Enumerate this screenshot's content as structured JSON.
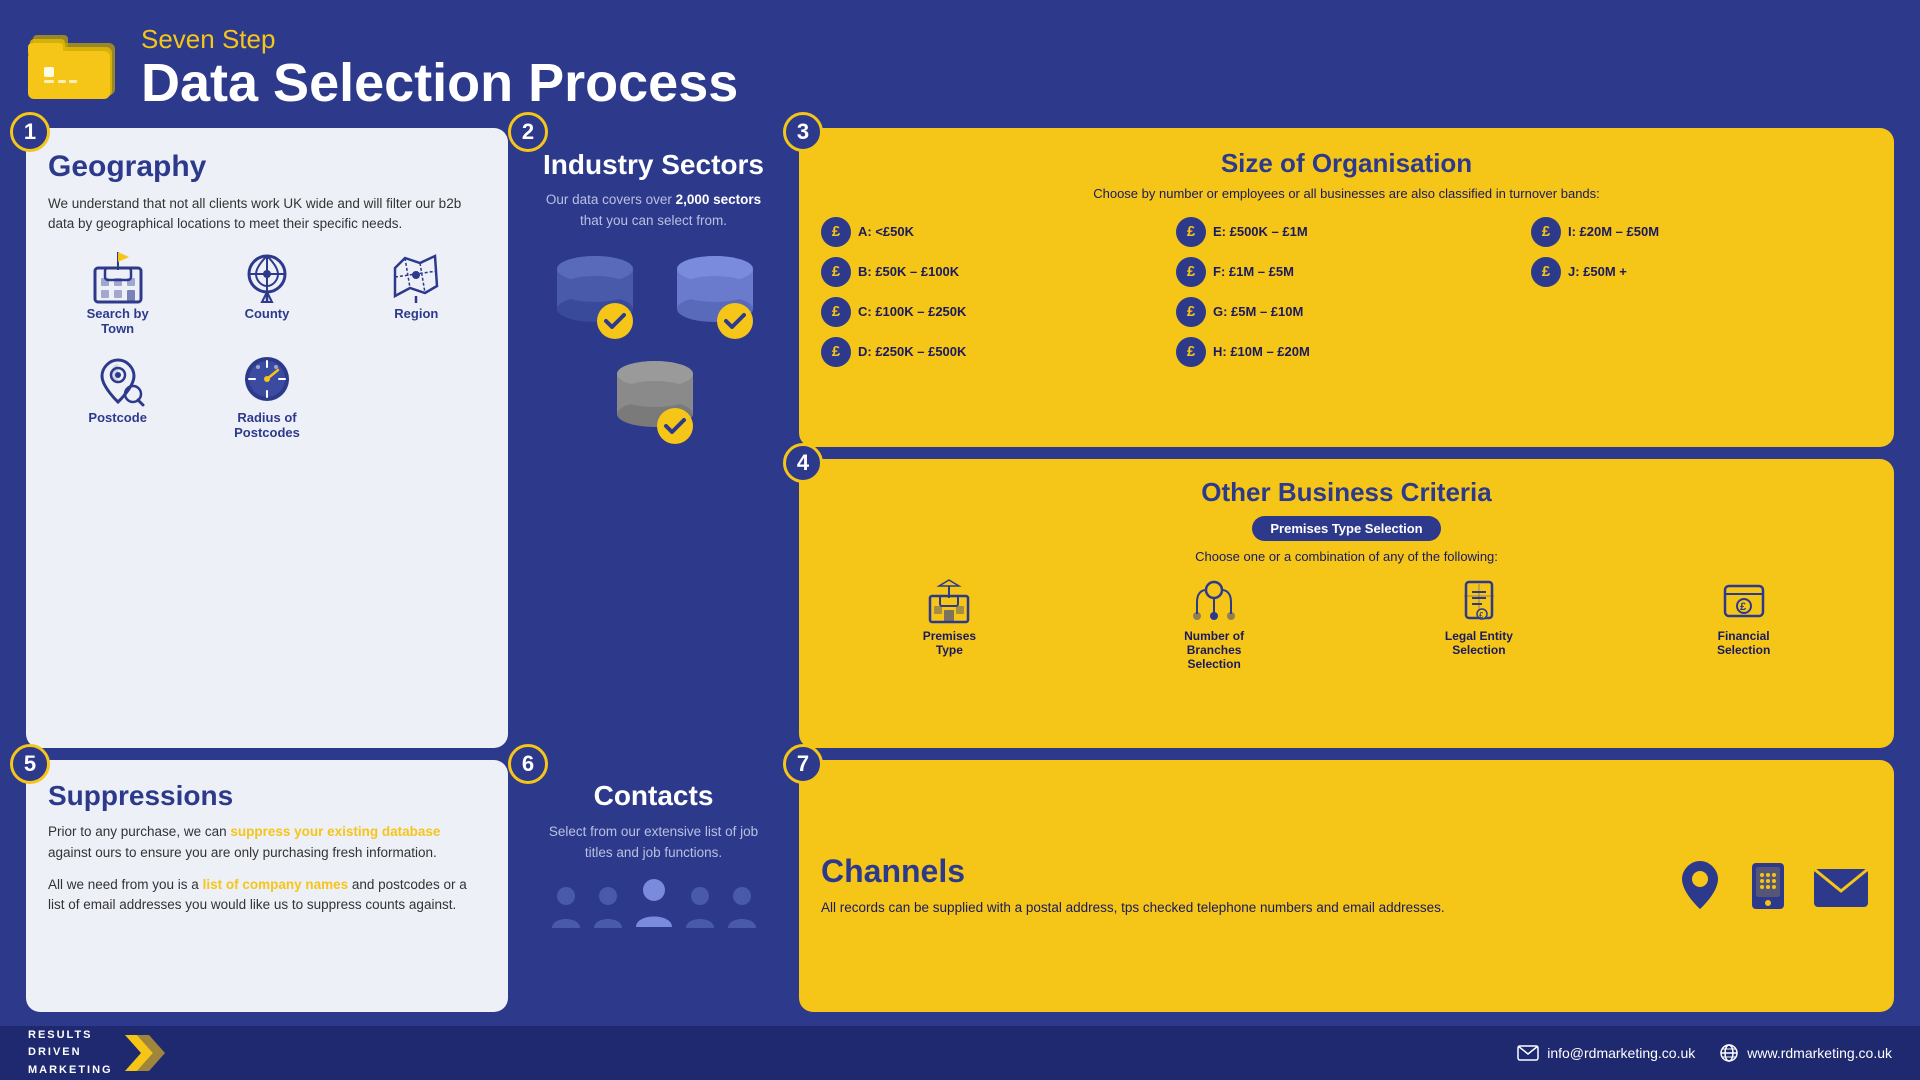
{
  "header": {
    "subtitle": "Seven Step",
    "title": "Data Selection Process"
  },
  "steps": {
    "step1": {
      "num": "1",
      "title": "Geography",
      "description": "We understand that not all clients work UK wide and will filter our b2b data by geographical locations to meet their specific needs.",
      "items": [
        {
          "label": "Search by Town"
        },
        {
          "label": "County"
        },
        {
          "label": "Region"
        },
        {
          "label": "Postcode"
        },
        {
          "label": "Radius of Postcodes"
        }
      ]
    },
    "step2": {
      "num": "2",
      "title": "Industry Sectors",
      "description": "Our data covers over 2,000 sectors that you can select from."
    },
    "step3": {
      "num": "3",
      "title": "Size of Organisation",
      "subtitle": "Choose by number or employees or all businesses are also classified in turnover bands:",
      "bands": [
        {
          "label": "A: <£50K"
        },
        {
          "label": "E: £500K – £1M"
        },
        {
          "label": "I: £20M – £50M"
        },
        {
          "label": "B: £50K – £100K"
        },
        {
          "label": "F: £1M – £5M"
        },
        {
          "label": "J: £50M +"
        },
        {
          "label": "C: £100K – £250K"
        },
        {
          "label": "G: £5M – £10M"
        },
        {
          "label": ""
        },
        {
          "label": "D: £250K – £500K"
        },
        {
          "label": "H: £10M – £20M"
        },
        {
          "label": ""
        }
      ]
    },
    "step4": {
      "num": "4",
      "title": "Other Business Criteria",
      "badge": "Premises Type Selection",
      "subtitle": "Choose one or a combination of any of the following:",
      "items": [
        {
          "label": "Premises Type"
        },
        {
          "label": "Number of Branches Selection"
        },
        {
          "label": "Legal Entity Selection"
        },
        {
          "label": "Financial Selection"
        }
      ]
    },
    "step5": {
      "num": "5",
      "title": "Suppressions",
      "description1": "Prior to any purchase, we can suppress your existing database against ours to ensure you are only purchasing fresh information.",
      "description2": "All we need from you is a list of company names and postcodes or a list of email addresses you would like us to suppress counts against.",
      "link_text": "suppress your existing database",
      "link_text2": "list of company names"
    },
    "step6": {
      "num": "6",
      "title": "Contacts",
      "description": "Select from our extensive list of job titles and job functions."
    },
    "step7": {
      "num": "7",
      "title": "Channels",
      "description": "All records can be supplied with a postal address, tps checked telephone numbers and email addresses."
    }
  },
  "footer": {
    "logo_lines": [
      "RESULTS",
      "DRIVEN",
      "MARKETING"
    ],
    "email": "info@rdmarketing.co.uk",
    "website": "www.rdmarketing.co.uk"
  }
}
